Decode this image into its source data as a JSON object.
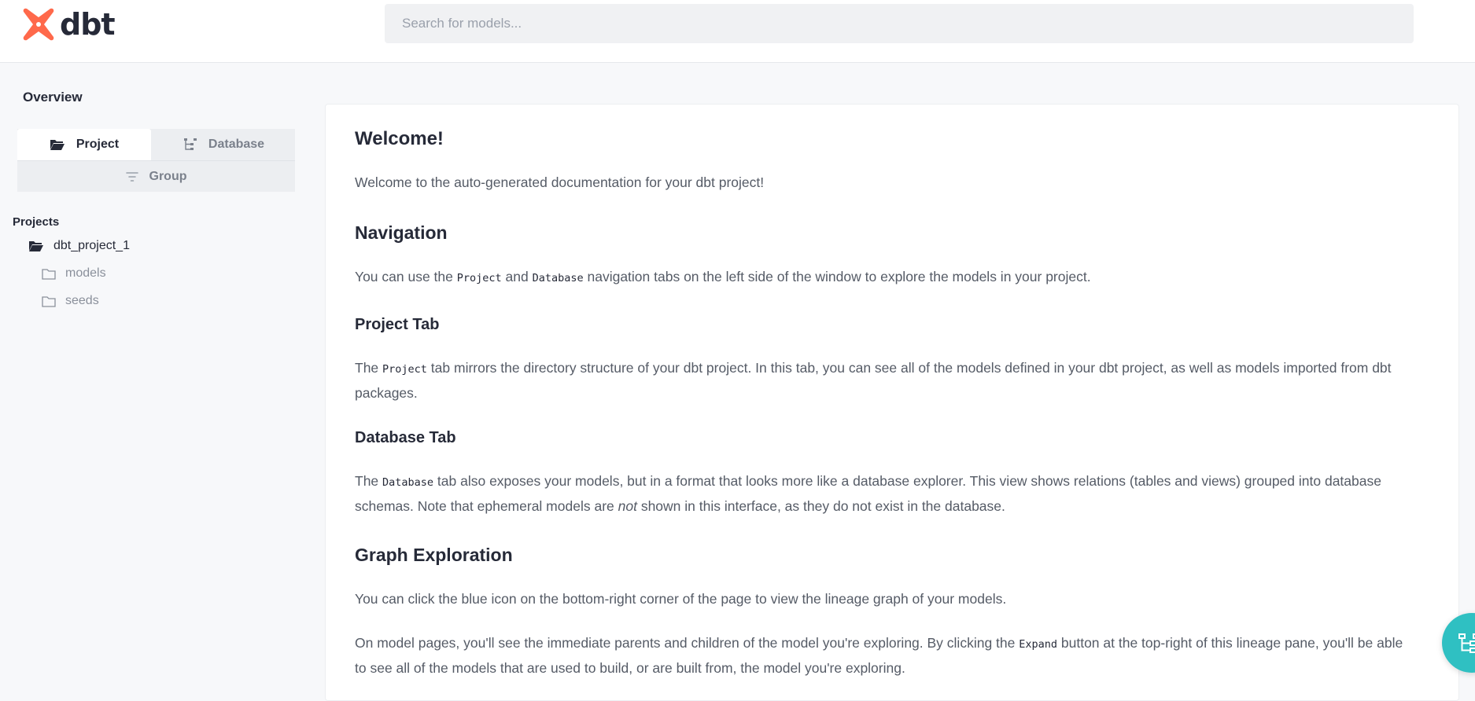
{
  "header": {
    "logo_text": "dbt",
    "search_placeholder": "Search for models..."
  },
  "sidebar": {
    "overview_label": "Overview",
    "tabs": {
      "project": "Project",
      "database": "Database",
      "group": "Group"
    },
    "projects_label": "Projects",
    "tree": {
      "project": "dbt_project_1",
      "folders": [
        "models",
        "seeds"
      ]
    }
  },
  "content": {
    "welcome_title": "Welcome!",
    "welcome_text": "Welcome to the auto-generated documentation for your dbt project!",
    "navigation_title": "Navigation",
    "navigation_text": {
      "before": "You can use the ",
      "code1": "Project",
      "mid": " and ",
      "code2": "Database",
      "after": " navigation tabs on the left side of the window to explore the models in your project."
    },
    "project_tab_title": "Project Tab",
    "project_tab_text": {
      "before": "The ",
      "code": "Project",
      "after": " tab mirrors the directory structure of your dbt project. In this tab, you can see all of the models defined in your dbt project, as well as models imported from dbt packages."
    },
    "database_tab_title": "Database Tab",
    "database_tab_text": {
      "before": "The ",
      "code": "Database",
      "mid": " tab also exposes your models, but in a format that looks more like a database explorer. This view shows relations (tables and views) grouped into database schemas. Note that ephemeral models are ",
      "em": "not",
      "after": " shown in this interface, as they do not exist in the database."
    },
    "graph_title": "Graph Exploration",
    "graph_text1": "You can click the blue icon on the bottom-right corner of the page to view the lineage graph of your models.",
    "graph_text2": {
      "before": "On model pages, you'll see the immediate parents and children of the model you're exploring. By clicking the ",
      "code": "Expand",
      "after": " button at the top-right of this lineage pane, you'll be able to see all of the models that are used to build, or are built from, the model you're exploring."
    }
  },
  "icons": {
    "logo": "dbt-logo-icon",
    "project_tab": "folder-open-icon",
    "database_tab": "tree-icon",
    "group_tab": "filter-icon",
    "project_tree": "folder-open-icon",
    "folder": "folder-icon",
    "fab": "lineage-graph-icon"
  },
  "colors": {
    "brand": "#ff694b",
    "fab": "#2fc0c2"
  }
}
